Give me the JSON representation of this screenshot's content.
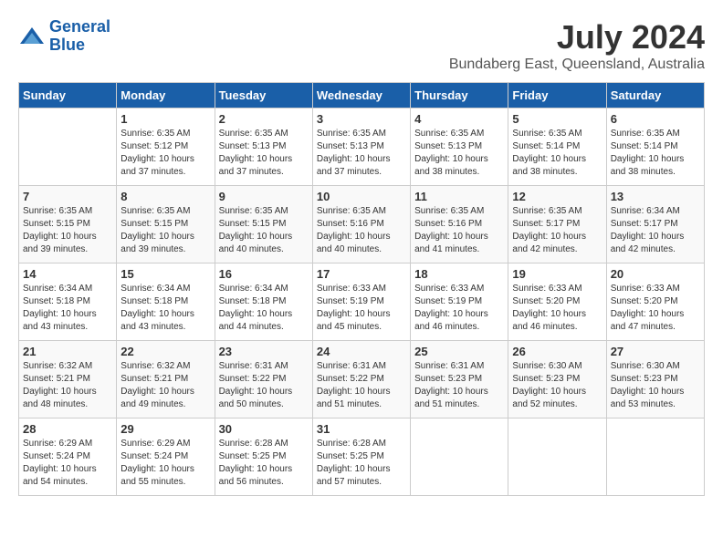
{
  "header": {
    "logo_line1": "General",
    "logo_line2": "Blue",
    "month_year": "July 2024",
    "location": "Bundaberg East, Queensland, Australia"
  },
  "days_of_week": [
    "Sunday",
    "Monday",
    "Tuesday",
    "Wednesday",
    "Thursday",
    "Friday",
    "Saturday"
  ],
  "weeks": [
    [
      {
        "day": "",
        "sunrise": "",
        "sunset": "",
        "daylight": ""
      },
      {
        "day": "1",
        "sunrise": "Sunrise: 6:35 AM",
        "sunset": "Sunset: 5:12 PM",
        "daylight": "Daylight: 10 hours and 37 minutes."
      },
      {
        "day": "2",
        "sunrise": "Sunrise: 6:35 AM",
        "sunset": "Sunset: 5:13 PM",
        "daylight": "Daylight: 10 hours and 37 minutes."
      },
      {
        "day": "3",
        "sunrise": "Sunrise: 6:35 AM",
        "sunset": "Sunset: 5:13 PM",
        "daylight": "Daylight: 10 hours and 37 minutes."
      },
      {
        "day": "4",
        "sunrise": "Sunrise: 6:35 AM",
        "sunset": "Sunset: 5:13 PM",
        "daylight": "Daylight: 10 hours and 38 minutes."
      },
      {
        "day": "5",
        "sunrise": "Sunrise: 6:35 AM",
        "sunset": "Sunset: 5:14 PM",
        "daylight": "Daylight: 10 hours and 38 minutes."
      },
      {
        "day": "6",
        "sunrise": "Sunrise: 6:35 AM",
        "sunset": "Sunset: 5:14 PM",
        "daylight": "Daylight: 10 hours and 38 minutes."
      }
    ],
    [
      {
        "day": "7",
        "sunrise": "Sunrise: 6:35 AM",
        "sunset": "Sunset: 5:15 PM",
        "daylight": "Daylight: 10 hours and 39 minutes."
      },
      {
        "day": "8",
        "sunrise": "Sunrise: 6:35 AM",
        "sunset": "Sunset: 5:15 PM",
        "daylight": "Daylight: 10 hours and 39 minutes."
      },
      {
        "day": "9",
        "sunrise": "Sunrise: 6:35 AM",
        "sunset": "Sunset: 5:15 PM",
        "daylight": "Daylight: 10 hours and 40 minutes."
      },
      {
        "day": "10",
        "sunrise": "Sunrise: 6:35 AM",
        "sunset": "Sunset: 5:16 PM",
        "daylight": "Daylight: 10 hours and 40 minutes."
      },
      {
        "day": "11",
        "sunrise": "Sunrise: 6:35 AM",
        "sunset": "Sunset: 5:16 PM",
        "daylight": "Daylight: 10 hours and 41 minutes."
      },
      {
        "day": "12",
        "sunrise": "Sunrise: 6:35 AM",
        "sunset": "Sunset: 5:17 PM",
        "daylight": "Daylight: 10 hours and 42 minutes."
      },
      {
        "day": "13",
        "sunrise": "Sunrise: 6:34 AM",
        "sunset": "Sunset: 5:17 PM",
        "daylight": "Daylight: 10 hours and 42 minutes."
      }
    ],
    [
      {
        "day": "14",
        "sunrise": "Sunrise: 6:34 AM",
        "sunset": "Sunset: 5:18 PM",
        "daylight": "Daylight: 10 hours and 43 minutes."
      },
      {
        "day": "15",
        "sunrise": "Sunrise: 6:34 AM",
        "sunset": "Sunset: 5:18 PM",
        "daylight": "Daylight: 10 hours and 43 minutes."
      },
      {
        "day": "16",
        "sunrise": "Sunrise: 6:34 AM",
        "sunset": "Sunset: 5:18 PM",
        "daylight": "Daylight: 10 hours and 44 minutes."
      },
      {
        "day": "17",
        "sunrise": "Sunrise: 6:33 AM",
        "sunset": "Sunset: 5:19 PM",
        "daylight": "Daylight: 10 hours and 45 minutes."
      },
      {
        "day": "18",
        "sunrise": "Sunrise: 6:33 AM",
        "sunset": "Sunset: 5:19 PM",
        "daylight": "Daylight: 10 hours and 46 minutes."
      },
      {
        "day": "19",
        "sunrise": "Sunrise: 6:33 AM",
        "sunset": "Sunset: 5:20 PM",
        "daylight": "Daylight: 10 hours and 46 minutes."
      },
      {
        "day": "20",
        "sunrise": "Sunrise: 6:33 AM",
        "sunset": "Sunset: 5:20 PM",
        "daylight": "Daylight: 10 hours and 47 minutes."
      }
    ],
    [
      {
        "day": "21",
        "sunrise": "Sunrise: 6:32 AM",
        "sunset": "Sunset: 5:21 PM",
        "daylight": "Daylight: 10 hours and 48 minutes."
      },
      {
        "day": "22",
        "sunrise": "Sunrise: 6:32 AM",
        "sunset": "Sunset: 5:21 PM",
        "daylight": "Daylight: 10 hours and 49 minutes."
      },
      {
        "day": "23",
        "sunrise": "Sunrise: 6:31 AM",
        "sunset": "Sunset: 5:22 PM",
        "daylight": "Daylight: 10 hours and 50 minutes."
      },
      {
        "day": "24",
        "sunrise": "Sunrise: 6:31 AM",
        "sunset": "Sunset: 5:22 PM",
        "daylight": "Daylight: 10 hours and 51 minutes."
      },
      {
        "day": "25",
        "sunrise": "Sunrise: 6:31 AM",
        "sunset": "Sunset: 5:23 PM",
        "daylight": "Daylight: 10 hours and 51 minutes."
      },
      {
        "day": "26",
        "sunrise": "Sunrise: 6:30 AM",
        "sunset": "Sunset: 5:23 PM",
        "daylight": "Daylight: 10 hours and 52 minutes."
      },
      {
        "day": "27",
        "sunrise": "Sunrise: 6:30 AM",
        "sunset": "Sunset: 5:23 PM",
        "daylight": "Daylight: 10 hours and 53 minutes."
      }
    ],
    [
      {
        "day": "28",
        "sunrise": "Sunrise: 6:29 AM",
        "sunset": "Sunset: 5:24 PM",
        "daylight": "Daylight: 10 hours and 54 minutes."
      },
      {
        "day": "29",
        "sunrise": "Sunrise: 6:29 AM",
        "sunset": "Sunset: 5:24 PM",
        "daylight": "Daylight: 10 hours and 55 minutes."
      },
      {
        "day": "30",
        "sunrise": "Sunrise: 6:28 AM",
        "sunset": "Sunset: 5:25 PM",
        "daylight": "Daylight: 10 hours and 56 minutes."
      },
      {
        "day": "31",
        "sunrise": "Sunrise: 6:28 AM",
        "sunset": "Sunset: 5:25 PM",
        "daylight": "Daylight: 10 hours and 57 minutes."
      },
      {
        "day": "",
        "sunrise": "",
        "sunset": "",
        "daylight": ""
      },
      {
        "day": "",
        "sunrise": "",
        "sunset": "",
        "daylight": ""
      },
      {
        "day": "",
        "sunrise": "",
        "sunset": "",
        "daylight": ""
      }
    ]
  ]
}
